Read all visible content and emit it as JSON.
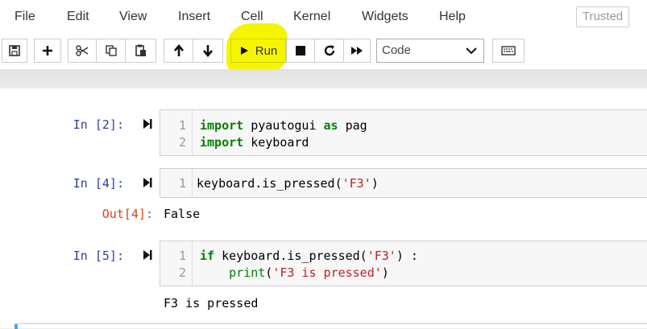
{
  "menu": [
    "File",
    "Edit",
    "View",
    "Insert",
    "Cell",
    "Kernel",
    "Widgets",
    "Help"
  ],
  "trusted_label": "Trusted",
  "toolbar": {
    "run_label": "Run",
    "cell_type": "Code",
    "highlight_color": "#f5f500"
  },
  "cells": [
    {
      "prompt": "In [2]:",
      "lines": [
        [
          {
            "t": "import",
            "c": "kw"
          },
          {
            "t": " pyautogui ",
            "c": ""
          },
          {
            "t": "as",
            "c": "kw"
          },
          {
            "t": " pag",
            "c": ""
          }
        ],
        [
          {
            "t": "import",
            "c": "kw"
          },
          {
            "t": " keyboard",
            "c": ""
          }
        ]
      ]
    },
    {
      "prompt": "In [4]:",
      "lines": [
        [
          {
            "t": "keyboard.is_pressed(",
            "c": ""
          },
          {
            "t": "'F3'",
            "c": "str"
          },
          {
            "t": ")",
            "c": ""
          }
        ]
      ],
      "out_prompt": "Out[4]:",
      "output": "False"
    },
    {
      "prompt": "In [5]:",
      "lines": [
        [
          {
            "t": "if",
            "c": "kw"
          },
          {
            "t": " keyboard.is_pressed(",
            "c": ""
          },
          {
            "t": "'F3'",
            "c": "str"
          },
          {
            "t": ") :",
            "c": ""
          }
        ],
        [
          {
            "t": "    ",
            "c": ""
          },
          {
            "t": "print",
            "c": "bi"
          },
          {
            "t": "(",
            "c": ""
          },
          {
            "t": "'F3 is pressed'",
            "c": "str"
          },
          {
            "t": ")",
            "c": ""
          }
        ]
      ],
      "output": "F3 is pressed"
    }
  ]
}
